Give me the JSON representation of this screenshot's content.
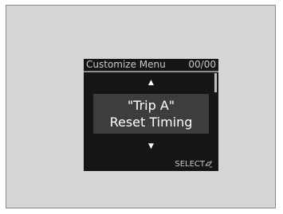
{
  "display": {
    "title": "Customize Menu",
    "page_count": "00/00",
    "item_line1": "\"Trip A\"",
    "item_line2": "Reset Timing",
    "up_arrow_icon": "chevron-up-icon",
    "down_arrow_icon": "chevron-down-icon",
    "up_arrow_glyph": "▲",
    "down_arrow_glyph": "▼",
    "select_hint": "SELECT",
    "select_icon": "selector-knob-icon"
  },
  "colors": {
    "frame_background": "#d5d5d5",
    "screen_background": "#161616",
    "selection_band": "#3d3d3d",
    "text_primary": "#ffffff",
    "text_secondary": "#c9c9c9"
  }
}
